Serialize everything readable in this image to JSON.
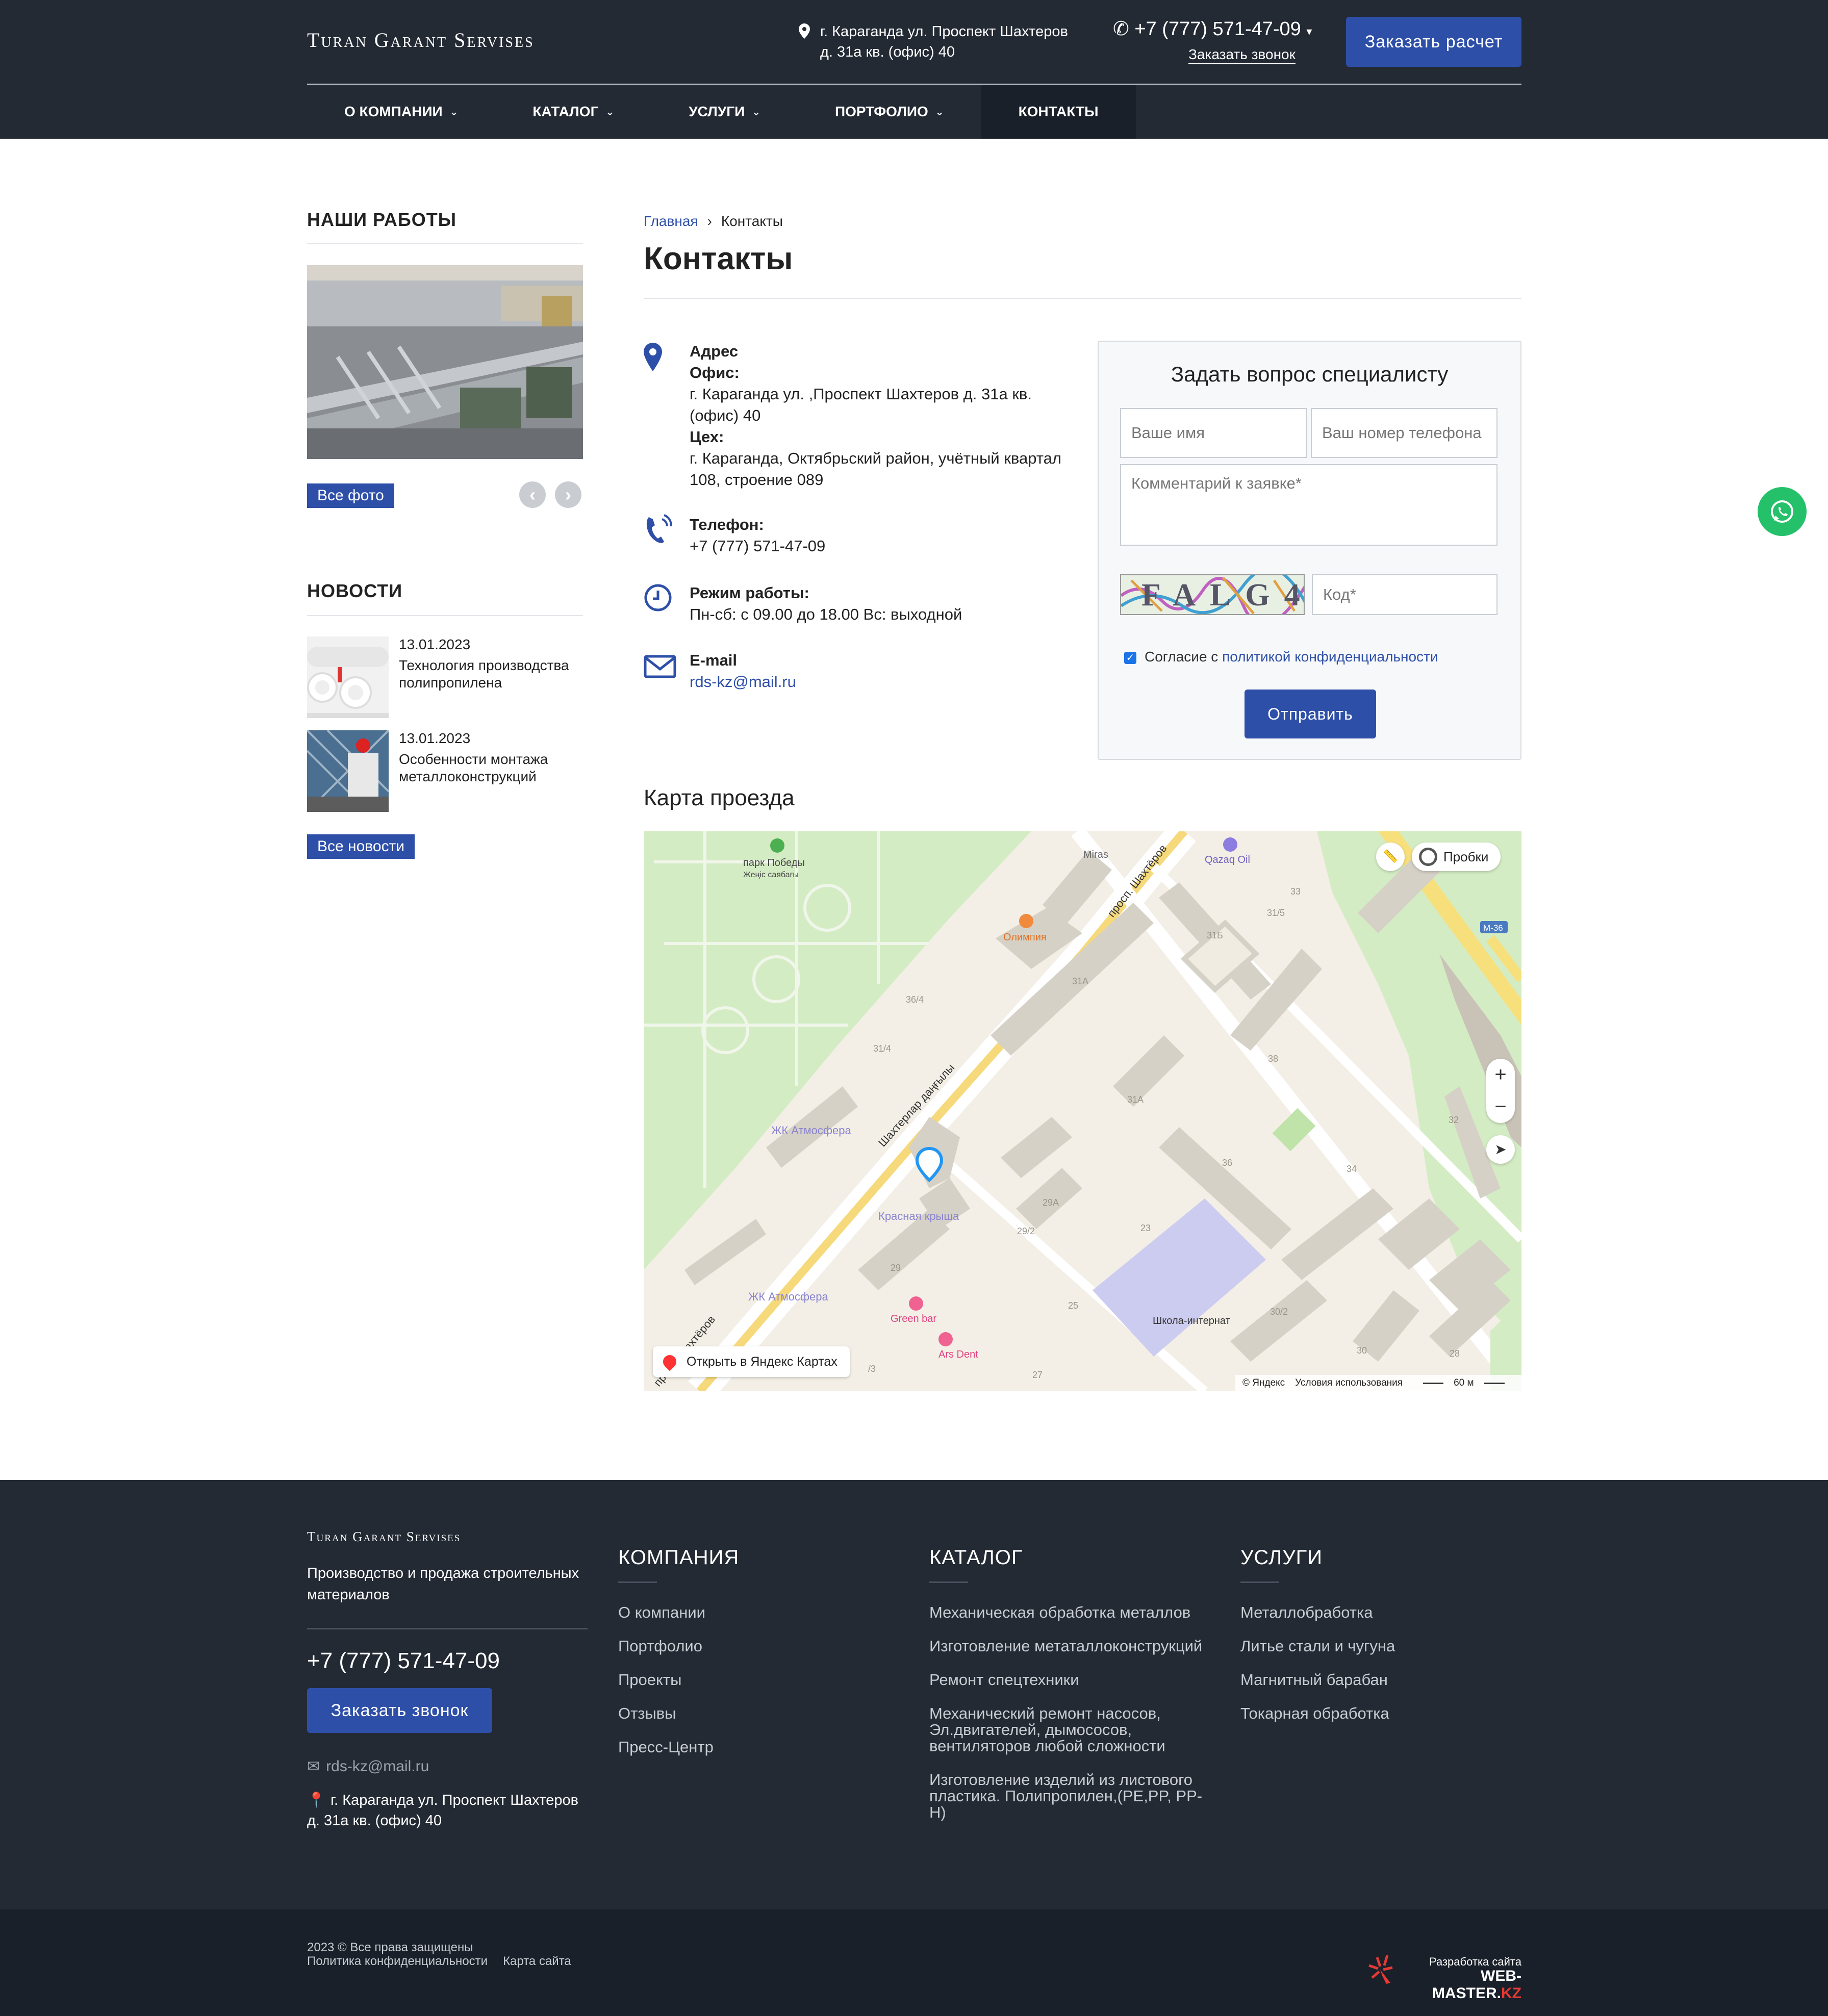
{
  "header": {
    "logo": "Turan Garant Servises",
    "address_line1": "г. Караганда ул. Проспект Шахтеров",
    "address_line2": "д. 31а кв. (офис) 40",
    "phone": "+7 (777) 571-47-09",
    "callback_link": "Заказать звонок",
    "order_button": "Заказать расчет"
  },
  "nav": [
    {
      "label": "О КОМПАНИИ",
      "dropdown": true
    },
    {
      "label": "КАТАЛОГ",
      "dropdown": true
    },
    {
      "label": "УСЛУГИ",
      "dropdown": true
    },
    {
      "label": "ПОРТФОЛИО",
      "dropdown": true
    },
    {
      "label": "КОНТАКТЫ",
      "dropdown": false,
      "active": true
    }
  ],
  "sidebar": {
    "works_title": "НАШИ РАБОТЫ",
    "all_photos": "Все фото",
    "news_title": "НОВОСТИ",
    "news": [
      {
        "date": "13.01.2023",
        "title": "Технология производства полипропилена"
      },
      {
        "date": "13.01.2023",
        "title": "Особенности монтажа металлоконструкций"
      }
    ],
    "all_news": "Все новости"
  },
  "breadcrumb": {
    "home": "Главная",
    "current": "Контакты"
  },
  "page_title": "Контакты",
  "contacts": {
    "address_label": "Адрес",
    "office_label": "Офис:",
    "office_value": "г. Караганда ул. ,Проспект Шахтеров д. 31а кв. (офис) 40",
    "workshop_label": "Цех:",
    "workshop_value": "г. Караганда, Октябрьский район, учётный квартал 108, строение 089",
    "phone_label": "Телефон:",
    "phone_value": "+7 (777) 571-47-09",
    "hours_label": "Режим работы:",
    "hours_value": "Пн-сб: с 09.00 до 18.00 Вс: выходной",
    "email_label": "E-mail",
    "email_value": "rds-kz@mail.ru"
  },
  "form": {
    "title": "Задать вопрос специалисту",
    "name_placeholder": "Ваше имя",
    "phone_placeholder": "Ваш номер телефона",
    "comment_placeholder": "Комментарий к заявке*",
    "captcha_text": "FALG4",
    "code_placeholder": "Код*",
    "consent_text": "Согласие с ",
    "consent_link": "политикой конфиденциальности",
    "submit": "Отправить"
  },
  "map": {
    "title": "Карта проезда",
    "traffic": "Пробки",
    "open_in": "Открыть в Яндекс Картах",
    "copyright": "© Яндекс",
    "terms": "Условия использования",
    "scale": "60 м",
    "labels": {
      "park": "парк Победы",
      "park_kz": "Жеңіс саябағы",
      "miras": "Miras",
      "qazaq": "Qazaq Oil",
      "olimpia": "Олимпия",
      "prospect_top": "просп. Шахтёров",
      "street_mid": "Шахтерлар даңғылы",
      "street_bottom": "просп. Шахтёров",
      "atmosfera1": "ЖК Атмосфера",
      "atmosfera2": "ЖК Атмосфера",
      "krasnaya": "Красная крыша",
      "greenbar": "Green bar",
      "arsdent": "Ars Dent",
      "school": "Школа-интернат",
      "m36": "М-36",
      "b33": "33",
      "b315": "31/5",
      "b31b": "31Б",
      "b31a": "31А",
      "b31a2": "31А",
      "b364": "36/4",
      "b314": "31/4",
      "b38": "38",
      "b36": "36",
      "b34": "34",
      "b32": "32",
      "b29a": "29А",
      "b292": "29/2",
      "b29": "29",
      "b23": "23",
      "b25": "25",
      "b302": "30/2",
      "b30": "30",
      "b28": "28",
      "b27": "27",
      "b3": "3",
      "b33b": "/3"
    }
  },
  "footer": {
    "logo": "Turan Garant Servises",
    "tagline": "Производство и продажа строительных материалов",
    "phone": "+7 (777) 571-47-09",
    "callback": "Заказать звонок",
    "email": "rds-kz@mail.ru",
    "address": "г. Караганда ул. Проспект Шахтеров д. 31а кв. (офис) 40",
    "company_title": "КОМПАНИЯ",
    "company": [
      "О компании",
      "Портфолио",
      "Проекты",
      "Отзывы",
      "Пресс-Центр"
    ],
    "catalog_title": "КАТАЛОГ",
    "catalog": [
      "Механическая обработка металлов",
      "Изготовление метаталлоконструкций",
      "Ремонт спецтехники",
      "Механический ремонт насосов, Эл.двигателей, дымососов, вентиляторов любой сложности",
      "Изготовление изделий из листового пластика. Полипропилен,(PE,PP, PP-H)"
    ],
    "services_title": "УСЛУГИ",
    "services": [
      "Металлобработка",
      "Литье стали и чугуна",
      "Магнитный барабан",
      "Токарная обработка"
    ]
  },
  "bottom": {
    "copyright": "2023 © Все права защищены",
    "privacy": "Политика конфиденциальности",
    "sitemap": "Карта сайта",
    "dev_label": "Разработка сайта",
    "dev_name": "WEB-MASTER.",
    "dev_tld": "KZ"
  },
  "colors": {
    "header_bg": "#232a34",
    "accent": "#2e4fa8",
    "whatsapp": "#25c16a"
  }
}
